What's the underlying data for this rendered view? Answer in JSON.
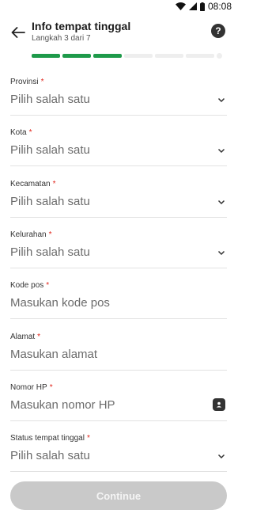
{
  "status_bar": {
    "time": "08:08"
  },
  "header": {
    "title": "Info tempat tinggal",
    "subtitle": "Langkah 3 dari 7",
    "help_glyph": "?"
  },
  "progress": {
    "current_step": 3,
    "total_steps": 7,
    "color_done": "#1e9a4a",
    "color_todo": "#eeeeee"
  },
  "fields": [
    {
      "label": "Provinsi",
      "value": "Pilih salah satu",
      "type": "select"
    },
    {
      "label": "Kota",
      "value": "Pilih salah satu",
      "type": "select"
    },
    {
      "label": "Kecamatan",
      "value": "Pilih salah satu",
      "type": "select"
    },
    {
      "label": "Kelurahan",
      "value": "Pilih salah satu",
      "type": "select"
    },
    {
      "label": "Kode pos",
      "value": "Masukan kode pos",
      "type": "input"
    },
    {
      "label": "Alamat",
      "value": "Masukan alamat",
      "type": "input"
    },
    {
      "label": "Nomor HP",
      "value": "Masukan nomor HP",
      "type": "input"
    },
    {
      "label": "Status tempat tinggal",
      "value": "Pilih salah satu",
      "type": "select"
    }
  ],
  "required_marker": "*",
  "continue_label": "Continue",
  "colors": {
    "required": "#e1251b",
    "button_disabled": "#c9c9c9"
  }
}
